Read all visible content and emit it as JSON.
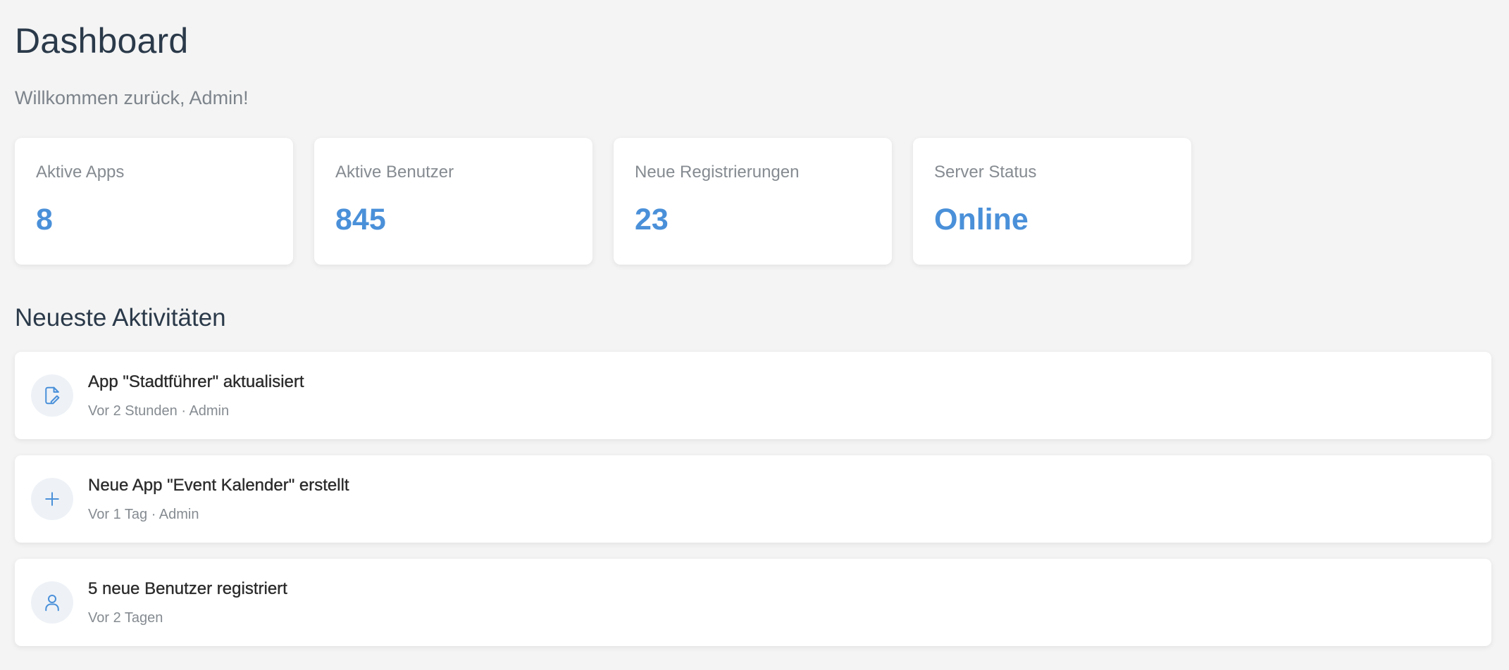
{
  "header": {
    "title": "Dashboard",
    "subtitle": "Willkommen zurück, Admin!"
  },
  "stats": [
    {
      "label": "Aktive Apps",
      "value": "8"
    },
    {
      "label": "Aktive Benutzer",
      "value": "845"
    },
    {
      "label": "Neue Registrierungen",
      "value": "23"
    },
    {
      "label": "Server Status",
      "value": "Online"
    }
  ],
  "activities": {
    "title": "Neueste Aktivitäten",
    "items": [
      {
        "icon": "file-edit-icon",
        "title": "App \"Stadtführer\" aktualisiert",
        "meta": "Vor 2 Stunden · Admin"
      },
      {
        "icon": "plus-icon",
        "title": "Neue App \"Event Kalender\" erstellt",
        "meta": "Vor 1 Tag · Admin"
      },
      {
        "icon": "user-icon",
        "title": "5 neue Benutzer registriert",
        "meta": "Vor 2 Tagen"
      }
    ]
  },
  "colors": {
    "accent": "#4a90d9",
    "background": "#f4f4f4",
    "heading": "#2b3a4a",
    "muted": "#858b91",
    "icon_bg": "#eef2f7"
  }
}
